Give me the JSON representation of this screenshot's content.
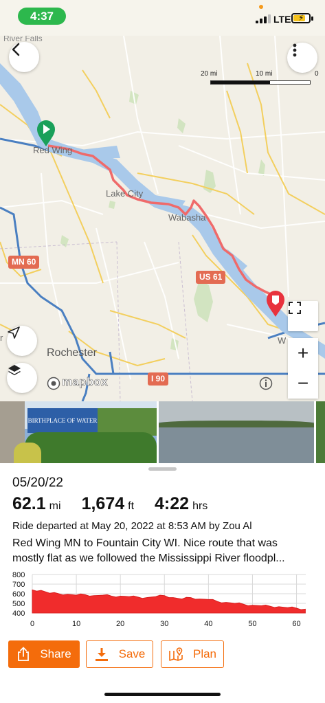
{
  "status_bar": {
    "time": "4:37",
    "network": "LTE"
  },
  "map": {
    "labels": {
      "top_town": "River Falls",
      "red_wing": "Red Wing",
      "lake_city": "Lake City",
      "wabasha": "Wabasha",
      "rochester": "Rochester",
      "winona": "W",
      "left_edge": "r"
    },
    "road_shields": {
      "mn60": "MN 60",
      "us61": "US 61",
      "i90": "I 90"
    },
    "scale": {
      "left": "20 mi",
      "middle": "10 mi",
      "right": "0"
    },
    "attribution": "mapbox",
    "icons": [
      "back-chevron-icon",
      "more-vertical-icon",
      "start-flag-icon",
      "end-pin-icon",
      "locate-icon",
      "layers-icon",
      "fullscreen-icon",
      "info-icon"
    ],
    "zoom_in": "+",
    "zoom_out": "−"
  },
  "photos": {
    "sign_text": "BIRTHPLACE OF WATER SKIING"
  },
  "ride": {
    "date": "05/20/22",
    "distance": "62.1",
    "distance_unit": "mi",
    "elevation": "1,674",
    "elevation_unit": "ft",
    "duration": "4:22",
    "duration_unit": "hrs",
    "departed": "Ride departed at May 20, 2022 at 8:53 AM by Zou Al",
    "description_line1": "Red Wing MN to Fountain City WI.  Nice route that was",
    "description_line2": "mostly flat as we followed the Mississippi River floodpl..."
  },
  "elevation_chart": {
    "y_ticks": [
      "800",
      "700",
      "600",
      "500",
      "400"
    ],
    "x_ticks": [
      "0",
      "10",
      "20",
      "30",
      "40",
      "50",
      "60"
    ]
  },
  "actions": {
    "share": "Share",
    "save": "Save",
    "plan": "Plan"
  },
  "colors": {
    "accent": "#f46c0b",
    "route": "#ef6a6a",
    "elevation_fill": "#f02c2c",
    "start": "#1aa05a",
    "end": "#e8323d"
  },
  "chart_data": {
    "type": "area",
    "xlabel": "",
    "ylabel": "",
    "xlim": [
      0,
      62.1
    ],
    "ylim": [
      400,
      800
    ],
    "x": [
      0,
      2,
      4,
      6,
      8,
      10,
      12,
      14,
      16,
      18,
      20,
      22,
      24,
      26,
      28,
      30,
      32,
      34,
      36,
      38,
      40,
      42,
      44,
      46,
      48,
      50,
      52,
      54,
      56,
      58,
      60,
      62
    ],
    "series": [
      {
        "values": [
          640,
          635,
          605,
          600,
          595,
          585,
          590,
          580,
          585,
          575,
          575,
          570,
          565,
          560,
          570,
          580,
          560,
          545,
          560,
          545,
          540,
          520,
          510,
          500,
          490,
          480,
          475,
          470,
          465,
          455,
          450,
          440
        ]
      }
    ]
  }
}
